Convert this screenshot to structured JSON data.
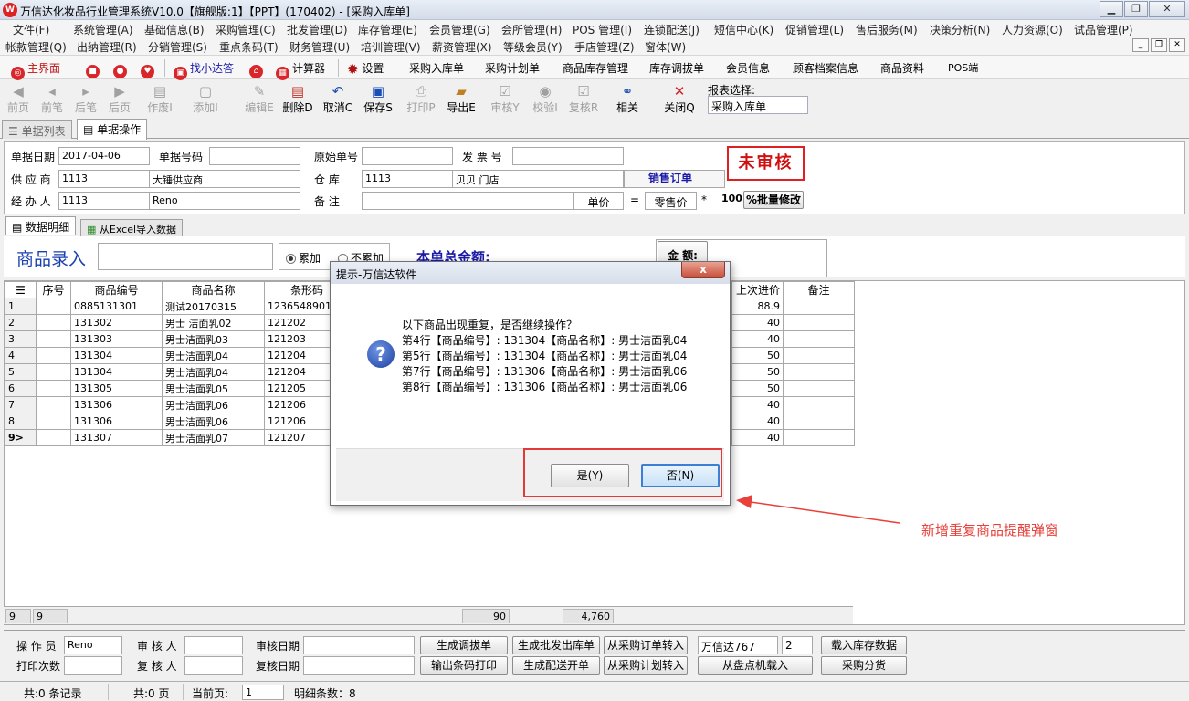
{
  "window": {
    "title": "万信达化妆品行业管理系统V10.0【旗舰版:1】【PPT】(170402) - [采购入库单]",
    "logo": "W"
  },
  "menu_row1": [
    "文件(F)",
    "系统管理(A)",
    "基础信息(B)",
    "采购管理(C)",
    "批发管理(D)",
    "库存管理(E)",
    "会员管理(G)",
    "会所管理(H)",
    "POS 管理(I)",
    "连锁配送(J)",
    "短信中心(K)",
    "促销管理(L)",
    "售后服务(M)",
    "决策分析(N)",
    "人力资源(O)",
    "试品管理(P)"
  ],
  "menu_row2": [
    "帐款管理(Q)",
    "出纳管理(R)",
    "分销管理(S)",
    "重点条码(T)",
    "财务管理(U)",
    "培训管理(V)",
    "薪资管理(X)",
    "等级会员(Y)",
    "手店管理(Z)",
    "窗体(W)"
  ],
  "quick": [
    "主界面",
    "找小达答",
    "计算器",
    "设置",
    "采购入库单",
    "采购计划单",
    "商品库存管理",
    "库存调拔单",
    "会员信息",
    "顾客档案信息",
    "商品资料",
    "POS端"
  ],
  "toolbar": [
    "前页",
    "前笔",
    "后笔",
    "后页",
    "作废I",
    "添加I",
    "编辑E",
    "删除D",
    "取消C",
    "保存S",
    "打印P",
    "导出E",
    "审核Y",
    "校验I",
    "复核R",
    "相关",
    "关闭Q"
  ],
  "report": {
    "label": "报表选择:",
    "value": "采购入库单"
  },
  "tabs": [
    "单据列表",
    "单据操作"
  ],
  "form": {
    "date_label": "单据日期",
    "date": "2017-04-06",
    "no_label": "单据号码",
    "no": "",
    "orig_label": "原始单号",
    "orig": "",
    "invoice_label": "发 票 号",
    "invoice": "",
    "supplier_label": "供 应 商",
    "supplier_code": "1113",
    "supplier_name": "大锤供应商",
    "warehouse_label": "仓    库",
    "warehouse_code": "1113",
    "warehouse_name": "贝贝 门店",
    "handler_label": "经 办 人",
    "handler_code": "1113",
    "handler_name": "Reno",
    "remark_label": "备    注",
    "remark": "",
    "sale_order": "销售订单",
    "unit_price_label": "单价",
    "eq": "=",
    "retail_label": "零售价",
    "star": "*",
    "pct": "100",
    "batch_btn": "%批量修改",
    "status_stamp": "未审核"
  },
  "tabs2": [
    "数据明细",
    "从Excel导入数据"
  ],
  "entry": {
    "label": "商品录入",
    "opt1": "累加",
    "opt2": "不累加",
    "total_label": "本单总金额:",
    "amt_btn": "金 额:"
  },
  "grid": {
    "headers": [
      "序号",
      "商品编号",
      "商品名称",
      "条形码",
      "上次进价",
      "备注"
    ],
    "rows": [
      {
        "n": "1",
        "code": "0885131301",
        "name": "测试20170315",
        "bar": "123654890131",
        "price": "88.9"
      },
      {
        "n": "2",
        "code": "131302",
        "name": "男士 洁面乳02",
        "bar": "121202",
        "price": "40"
      },
      {
        "n": "3",
        "code": "131303",
        "name": "男士洁面乳03",
        "bar": "121203",
        "price": "40"
      },
      {
        "n": "4",
        "code": "131304",
        "name": "男士洁面乳04",
        "bar": "121204",
        "price": "50"
      },
      {
        "n": "5",
        "code": "131304",
        "name": "男士洁面乳04",
        "bar": "121204",
        "price": "50"
      },
      {
        "n": "6",
        "code": "131305",
        "name": "男士洁面乳05",
        "bar": "121205",
        "price": "50"
      },
      {
        "n": "7",
        "code": "131306",
        "name": "男士洁面乳06",
        "bar": "121206",
        "price": "40"
      },
      {
        "n": "8",
        "code": "131306",
        "name": "男士洁面乳06",
        "bar": "121206",
        "price": "40"
      },
      {
        "n": "9>",
        "code": "131307",
        "name": "男士洁面乳07",
        "bar": "121207",
        "price": "40"
      }
    ],
    "sum": {
      "count_a": "9",
      "count_b": "9",
      "qty": "90",
      "amount": "4,760"
    }
  },
  "bottom": {
    "operator_label": "操 作 员",
    "operator": "Reno",
    "auditor_label": "审 核 人",
    "auditor": "",
    "audit_date_label": "审核日期",
    "audit_date": "",
    "print_label": "打印次数",
    "print": "",
    "reviewer_label": "复 核 人",
    "reviewer": "",
    "review_date_label": "复核日期",
    "review_date": "",
    "btns": [
      "生成调拔单",
      "生成批发出库单",
      "从采购订单转入",
      "输出条码打印",
      "生成配送开单",
      "从采购计划转入",
      "从盘点机载入",
      "载入库存数据",
      "采购分货"
    ],
    "store": "万信达767",
    "store_no": "2"
  },
  "status": {
    "records": "共:0 条记录",
    "pages": "共:0 页",
    "cur_label": "当前页:",
    "cur": "1",
    "detail": "明细条数：8"
  },
  "dialog": {
    "title": "提示-万信达软件",
    "close": "x",
    "icon": "?",
    "lines": [
      "以下商品出现重复，是否继续操作？",
      "第4行【商品编号】: 131304【商品名称】: 男士洁面乳04",
      "第5行【商品编号】: 131304【商品名称】: 男士洁面乳04",
      "第7行【商品编号】: 131306【商品名称】: 男士洁面乳06",
      "第8行【商品编号】: 131306【商品名称】: 男士洁面乳06"
    ],
    "yes": "是(Y)",
    "no": "否(N)"
  },
  "annotation": "新增重复商品提醒弹窗",
  "colors": {
    "annotation": "#e8403a",
    "stamp": "#d01010",
    "link_blue": "#1a1aa8"
  }
}
